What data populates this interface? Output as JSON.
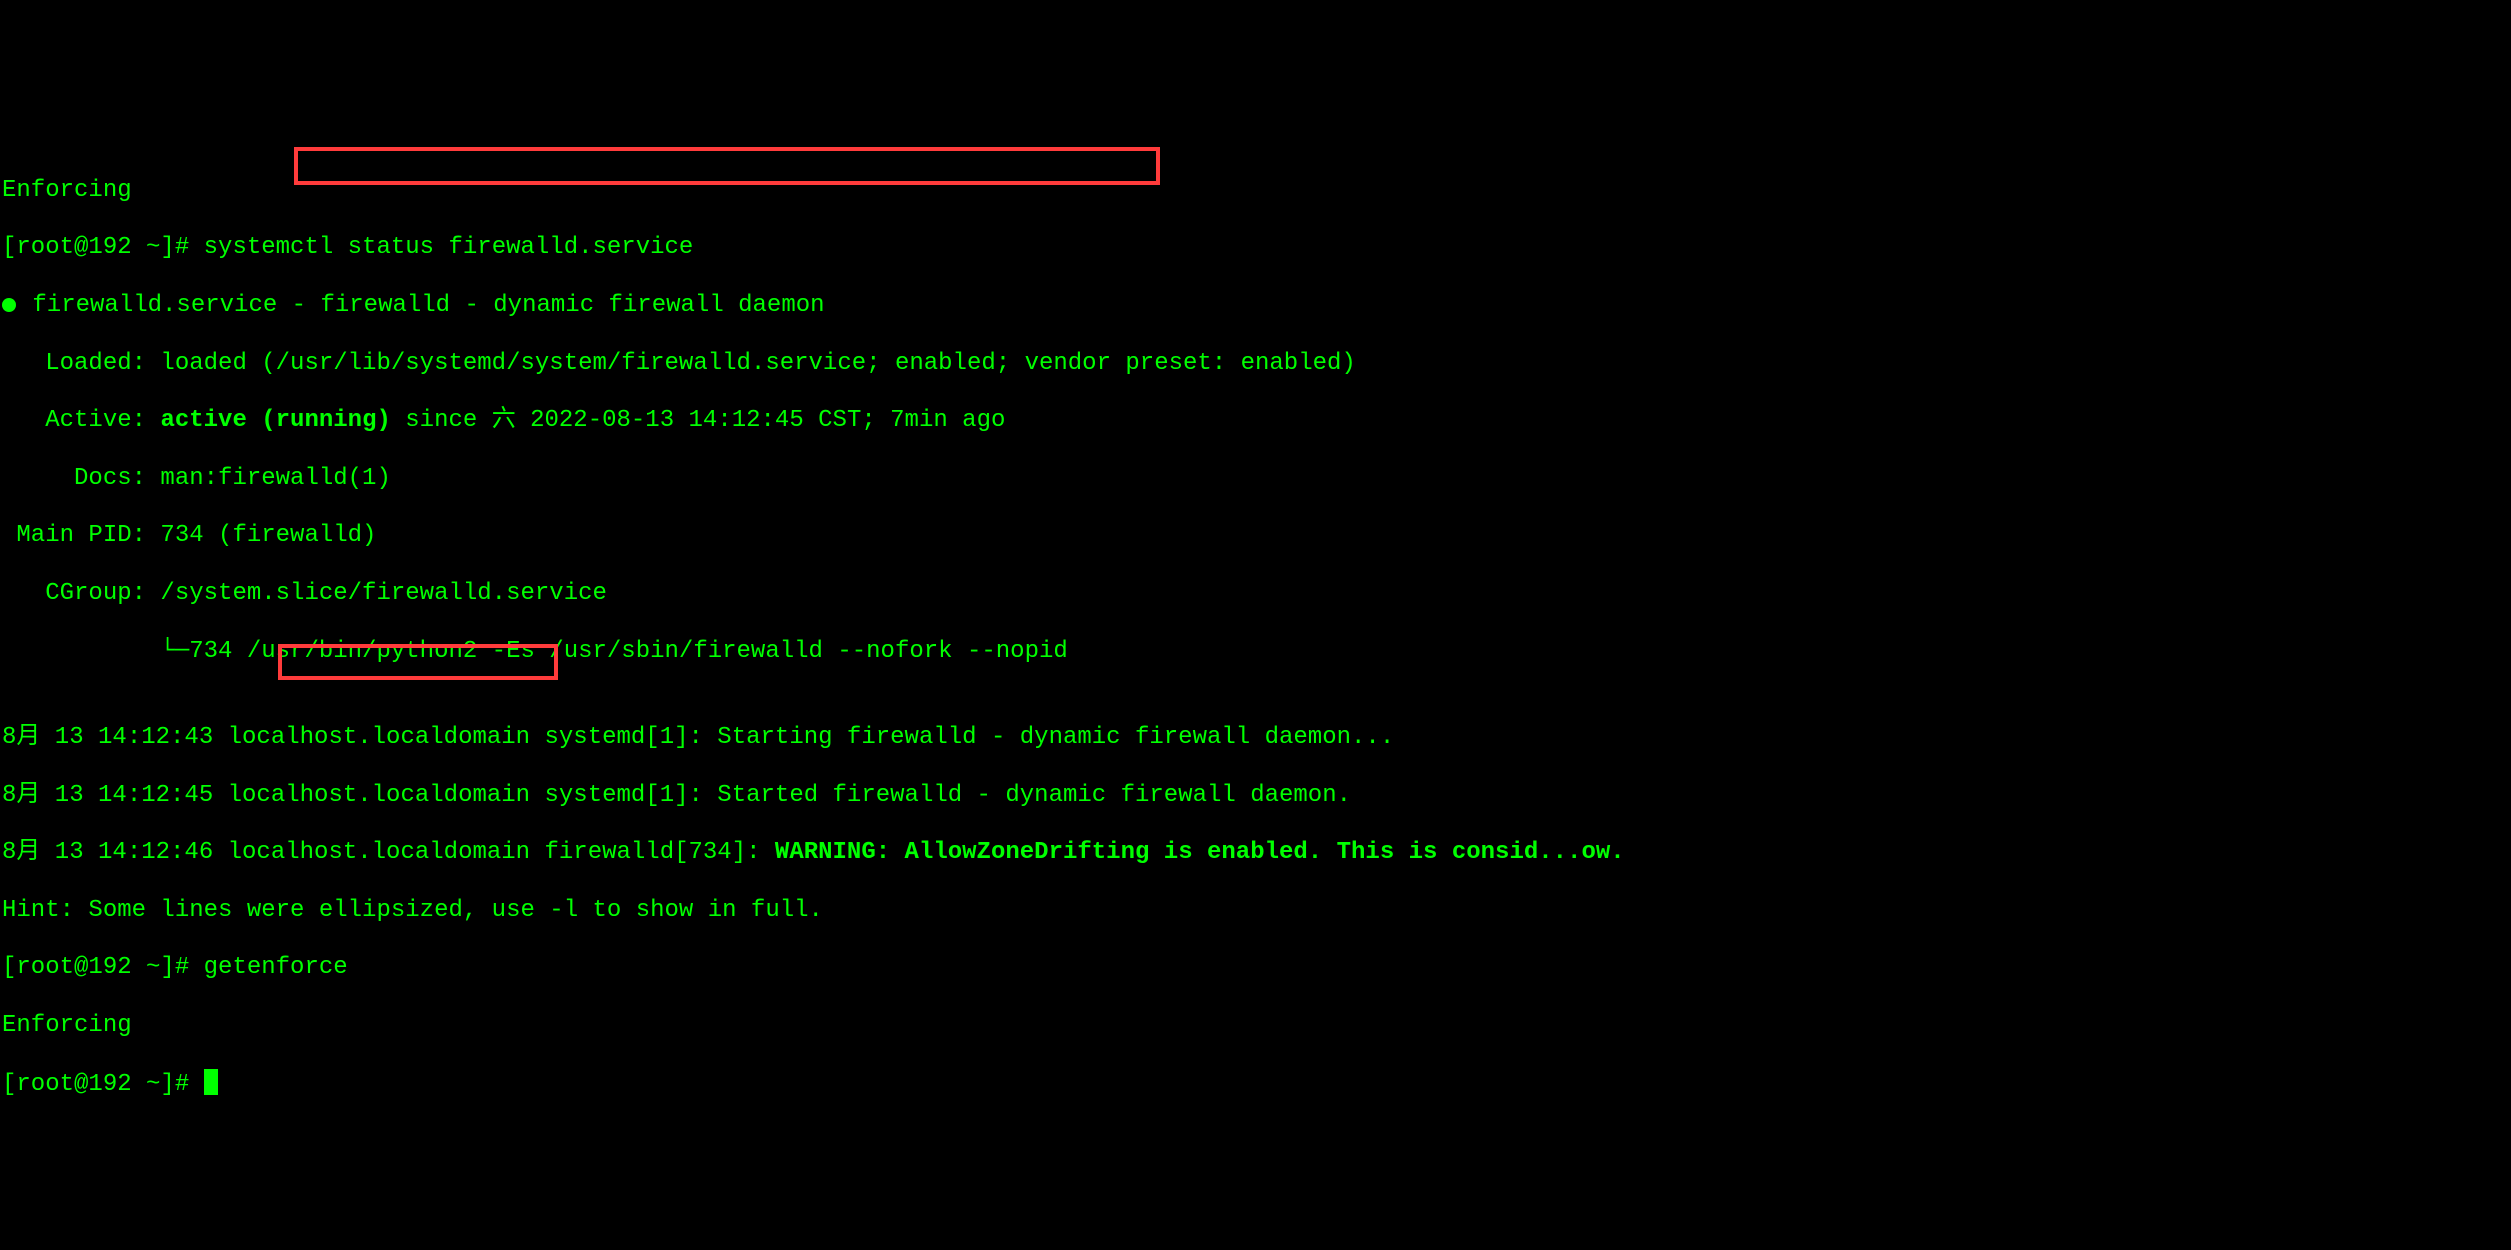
{
  "lines": {
    "l0_prefix": "Enforcing",
    "l1_prompt": "[root@192 ~]# ",
    "l1_cmd": "systemctl status firewalld.service",
    "l2_pre": "● ",
    "l2_txt": "firewalld.service - firewalld - dynamic firewall daemon",
    "l3": "   Loaded: loaded (/usr/lib/systemd/system/firewalld.service; enabled; vendor preset: enabled)",
    "l4_a": "   Active: ",
    "l4_b": "active (running)",
    "l4_c": " since 六 2022-08-13 14:12:45 CST; 7min ago",
    "l5": "     Docs: man:firewalld(1)",
    "l6": " Main PID: 734 (firewalld)",
    "l7": "   CGroup: /system.slice/firewalld.service",
    "l8": "           └─734 /usr/bin/python2 -Es /usr/sbin/firewalld --nofork --nopid",
    "l9": "",
    "l10": "8月 13 14:12:43 localhost.localdomain systemd[1]: Starting firewalld - dynamic firewall daemon...",
    "l11": "8月 13 14:12:45 localhost.localdomain systemd[1]: Started firewalld - dynamic firewall daemon.",
    "l12_a": "8月 13 14:12:46 localhost.localdomain firewalld[734]: ",
    "l12_b": "WARNING: AllowZoneDrifting is enabled. This is consid...ow.",
    "l13": "Hint: Some lines were ellipsized, use -l to show in full.",
    "l14_prompt": "[root@192 ~]# ",
    "l14_cmd": "getenforce",
    "l15": "Enforcing",
    "l16_prompt": "[root@192 ~]# "
  }
}
